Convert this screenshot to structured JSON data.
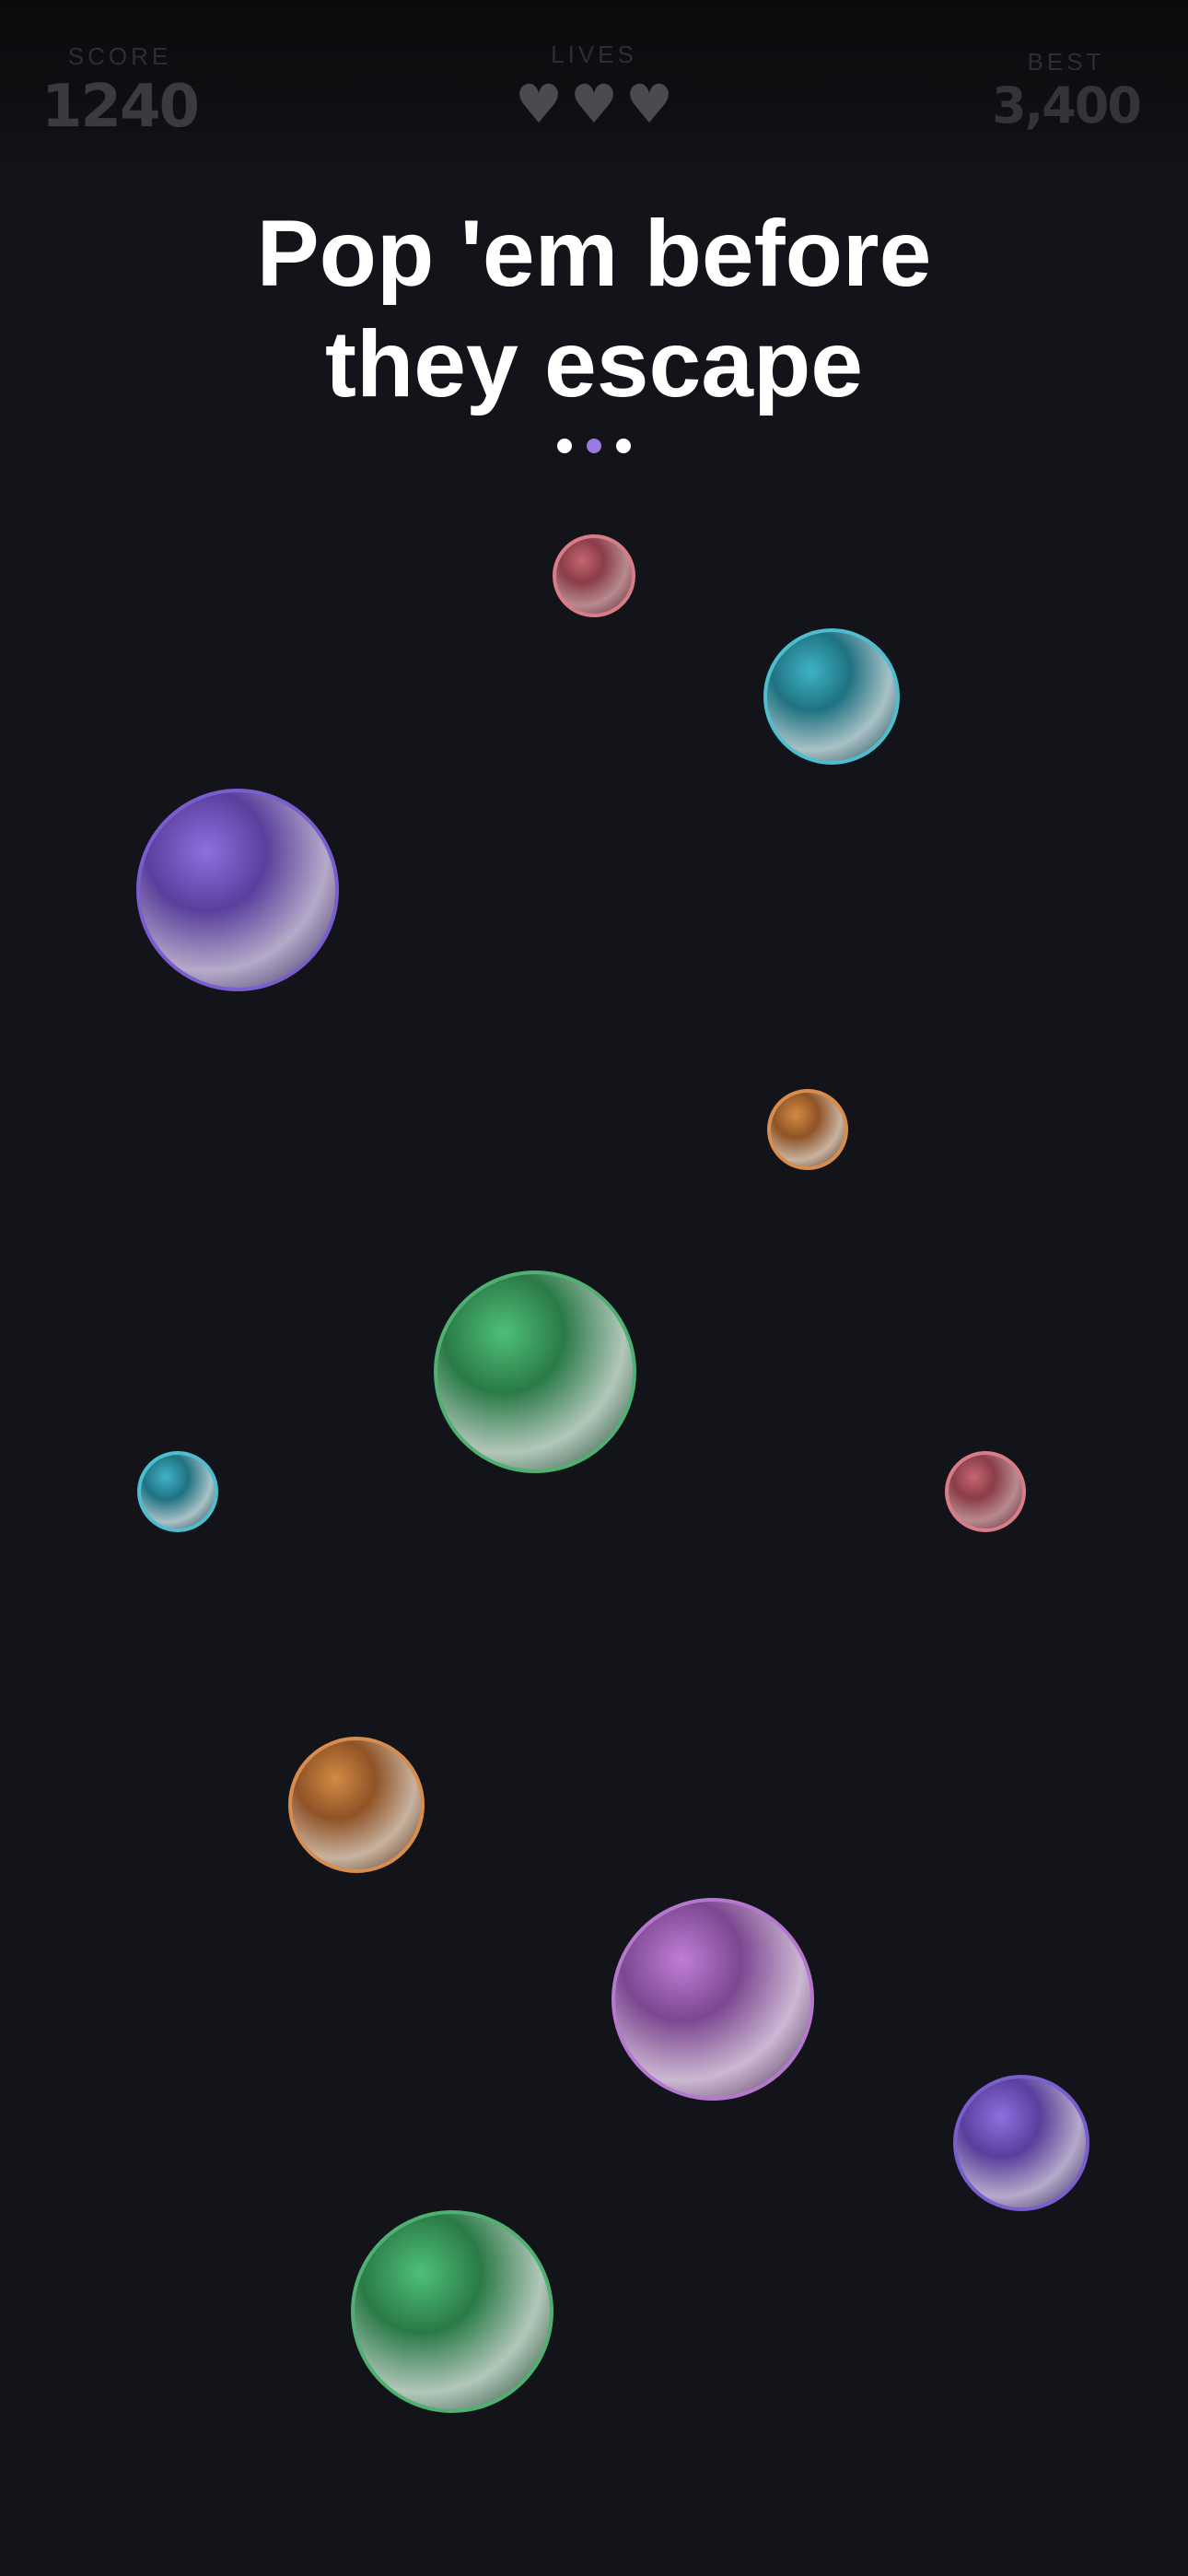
{
  "hud": {
    "score_label": "SCORE",
    "score_value": "1240",
    "lives_label": "LIVES",
    "lives_count": 3,
    "lives_glyph": "♥",
    "best_label": "BEST",
    "best_value": "3,400"
  },
  "headline": {
    "line1": "Pop 'em before",
    "line2": "they escape"
  },
  "pager": {
    "count": 3,
    "active_index": 1,
    "active_color": "#9a7ae0"
  },
  "bubbles": [
    {
      "color": "red"
    },
    {
      "color": "cyan"
    },
    {
      "color": "purple"
    },
    {
      "color": "orange"
    },
    {
      "color": "green"
    },
    {
      "color": "cyan"
    },
    {
      "color": "red"
    },
    {
      "color": "orange"
    },
    {
      "color": "magenta"
    },
    {
      "color": "purple"
    },
    {
      "color": "green"
    }
  ]
}
